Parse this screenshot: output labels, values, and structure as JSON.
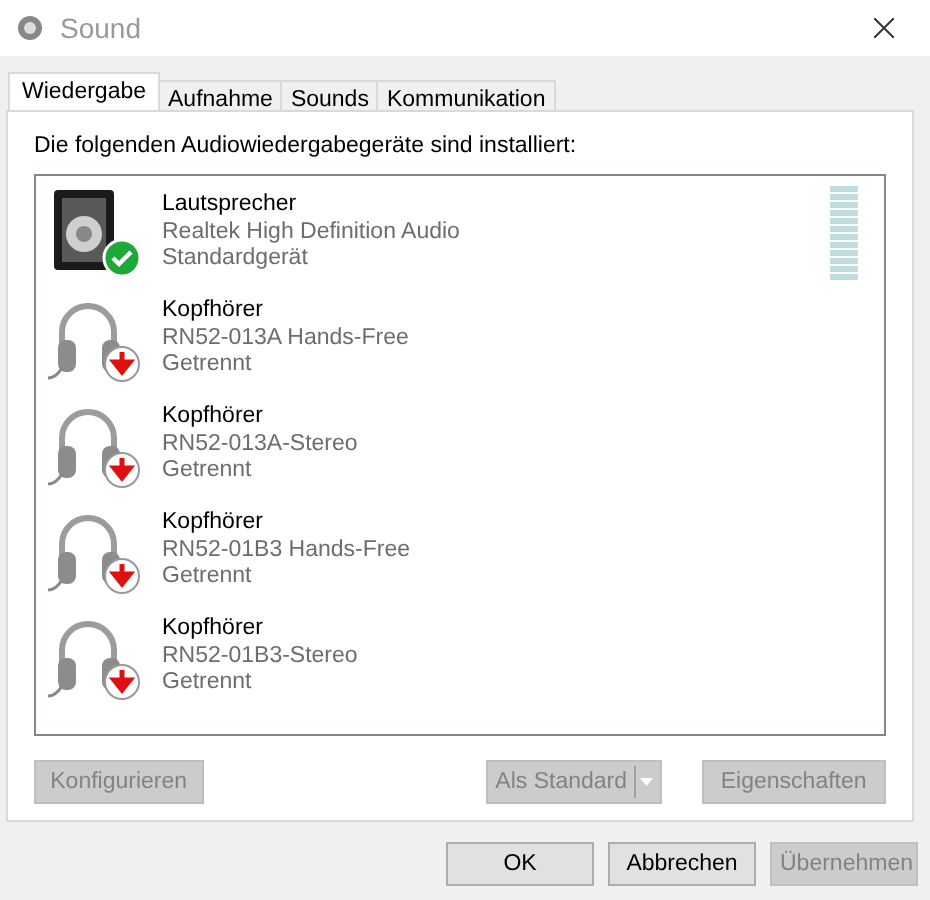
{
  "window": {
    "title": "Sound"
  },
  "tabs": [
    {
      "label": "Wiedergabe",
      "selected": true
    },
    {
      "label": "Aufnahme",
      "selected": false
    },
    {
      "label": "Sounds",
      "selected": false
    },
    {
      "label": "Kommunikation",
      "selected": false
    }
  ],
  "intro": "Die folgenden Audiowiedergabegeräte sind installiert:",
  "devices": [
    {
      "kind": "speaker",
      "default_device": true,
      "disconnected": false,
      "name": "Lautsprecher",
      "detail": "Realtek High Definition Audio",
      "status": "Standardgerät",
      "level": 0
    },
    {
      "kind": "headphones",
      "default_device": false,
      "disconnected": true,
      "name": "Kopfhörer",
      "detail": "RN52-013A Hands-Free",
      "status": "Getrennt"
    },
    {
      "kind": "headphones",
      "default_device": false,
      "disconnected": true,
      "name": "Kopfhörer",
      "detail": "RN52-013A-Stereo",
      "status": "Getrennt"
    },
    {
      "kind": "headphones",
      "default_device": false,
      "disconnected": true,
      "name": "Kopfhörer",
      "detail": "RN52-01B3 Hands-Free",
      "status": "Getrennt"
    },
    {
      "kind": "headphones",
      "default_device": false,
      "disconnected": true,
      "name": "Kopfhörer",
      "detail": "RN52-01B3-Stereo",
      "status": "Getrennt"
    }
  ],
  "panel_buttons": [
    {
      "kind": "plain",
      "label": "Konfigurieren",
      "disabled": true
    },
    {
      "kind": "split",
      "label": "Als Standard",
      "disabled": true
    },
    {
      "kind": "plain",
      "label": "Eigenschaften",
      "disabled": true
    }
  ],
  "dialog_buttons": [
    {
      "label": "OK",
      "disabled": false
    },
    {
      "label": "Abbrechen",
      "disabled": false
    },
    {
      "label": "Übernehmen",
      "disabled": true
    }
  ]
}
